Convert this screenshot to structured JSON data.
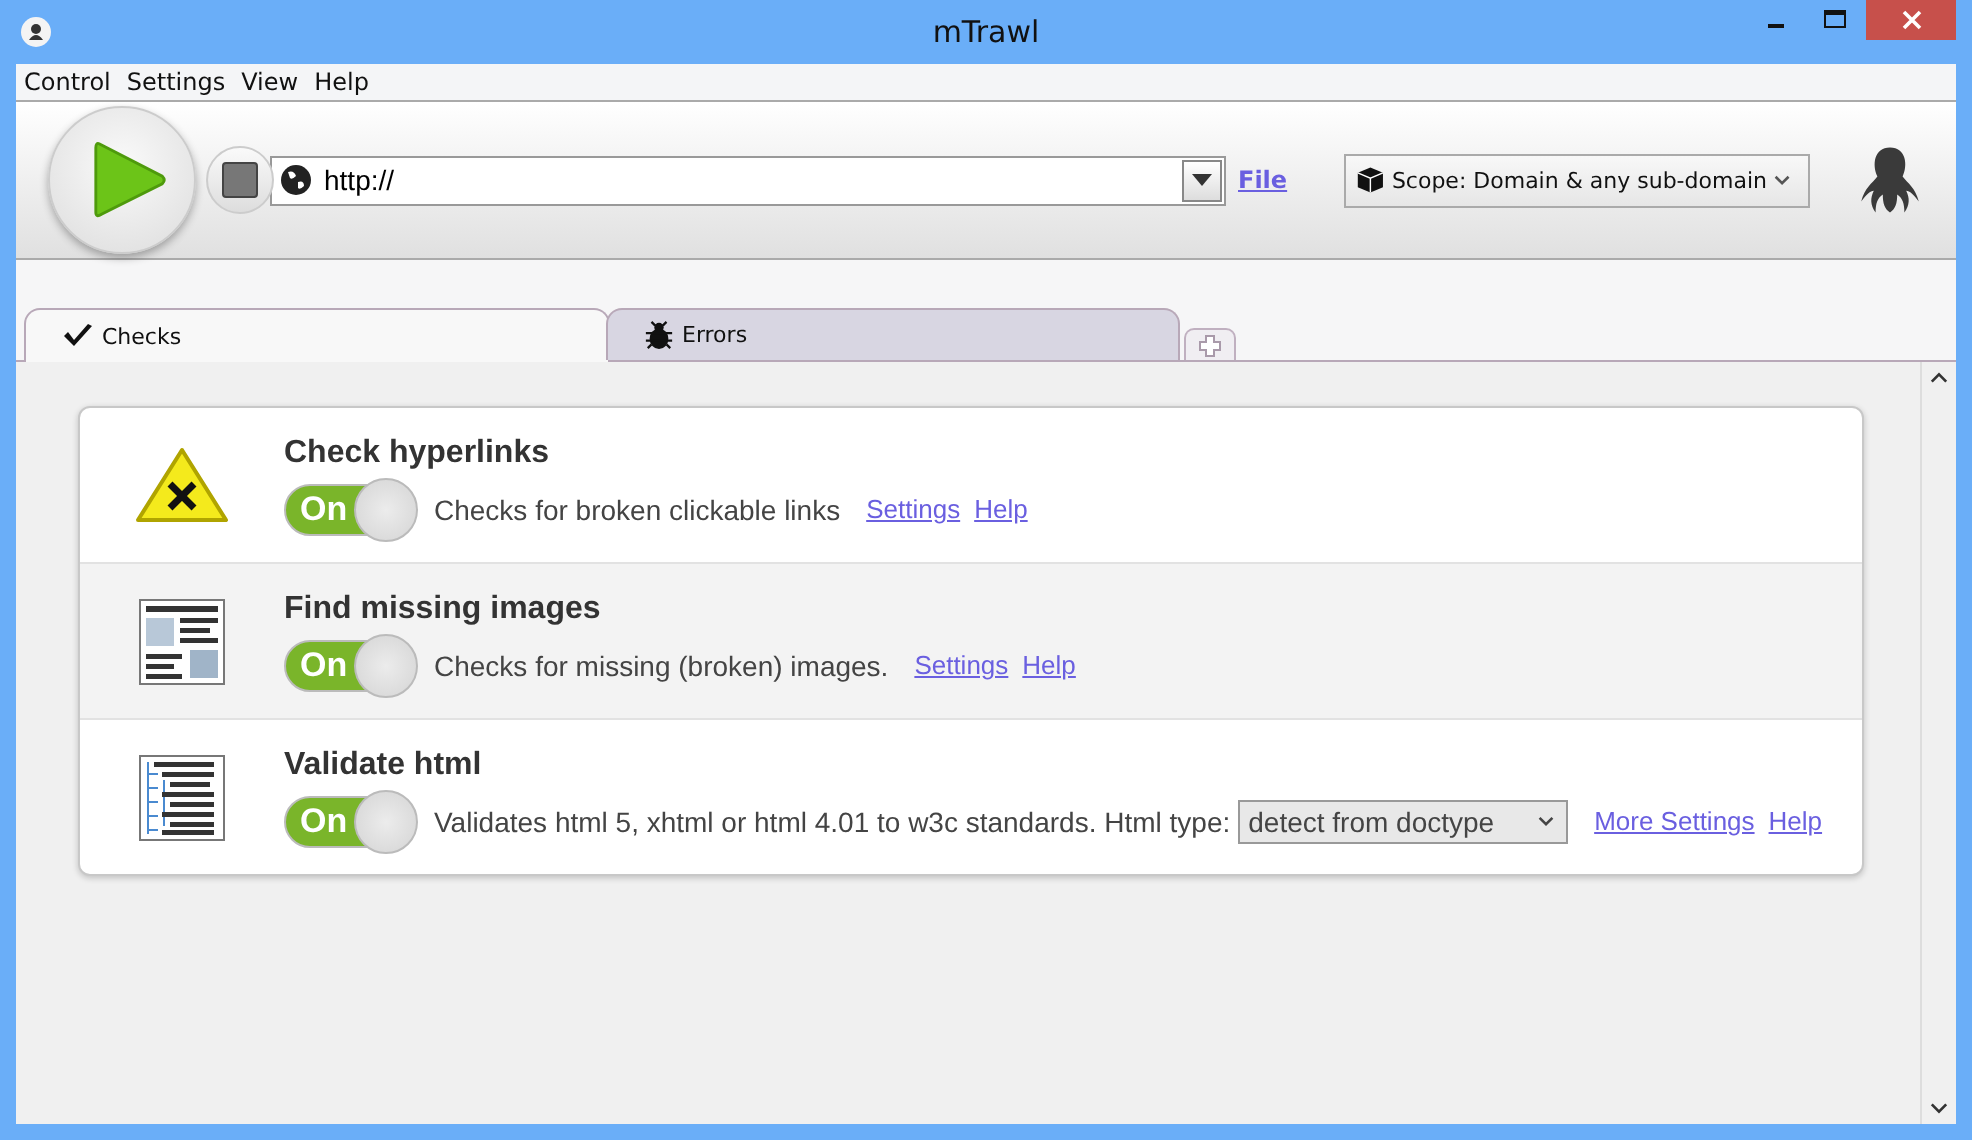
{
  "window": {
    "title": "mTrawl"
  },
  "menu": [
    "Control",
    "Settings",
    "View",
    "Help"
  ],
  "toolbar": {
    "url": {
      "value": "http://"
    },
    "file_link": "File",
    "scope": {
      "value": "Scope: Domain & any sub-domain"
    }
  },
  "tabs": [
    {
      "label": "Checks",
      "selected": true
    },
    {
      "label": "Errors",
      "selected": false
    }
  ],
  "checks": [
    {
      "kind": "hyperlinks",
      "title": "Check hyperlinks",
      "on": true,
      "toggle_label": "On",
      "description": "Checks for broken clickable links",
      "selected": false,
      "links": [
        "Settings",
        "Help"
      ]
    },
    {
      "kind": "images",
      "title": "Find missing images",
      "on": true,
      "toggle_label": "On",
      "description": "Checks for missing (broken) images.",
      "selected": true,
      "links": [
        "Settings",
        "Help"
      ]
    },
    {
      "kind": "html",
      "title": "Validate html",
      "on": true,
      "toggle_label": "On",
      "description": "Validates html 5, xhtml or html 4.01 to w3c standards. Html type:",
      "select": "detect from doctype",
      "selected": false,
      "links": [
        "More Settings",
        "Help"
      ]
    }
  ]
}
